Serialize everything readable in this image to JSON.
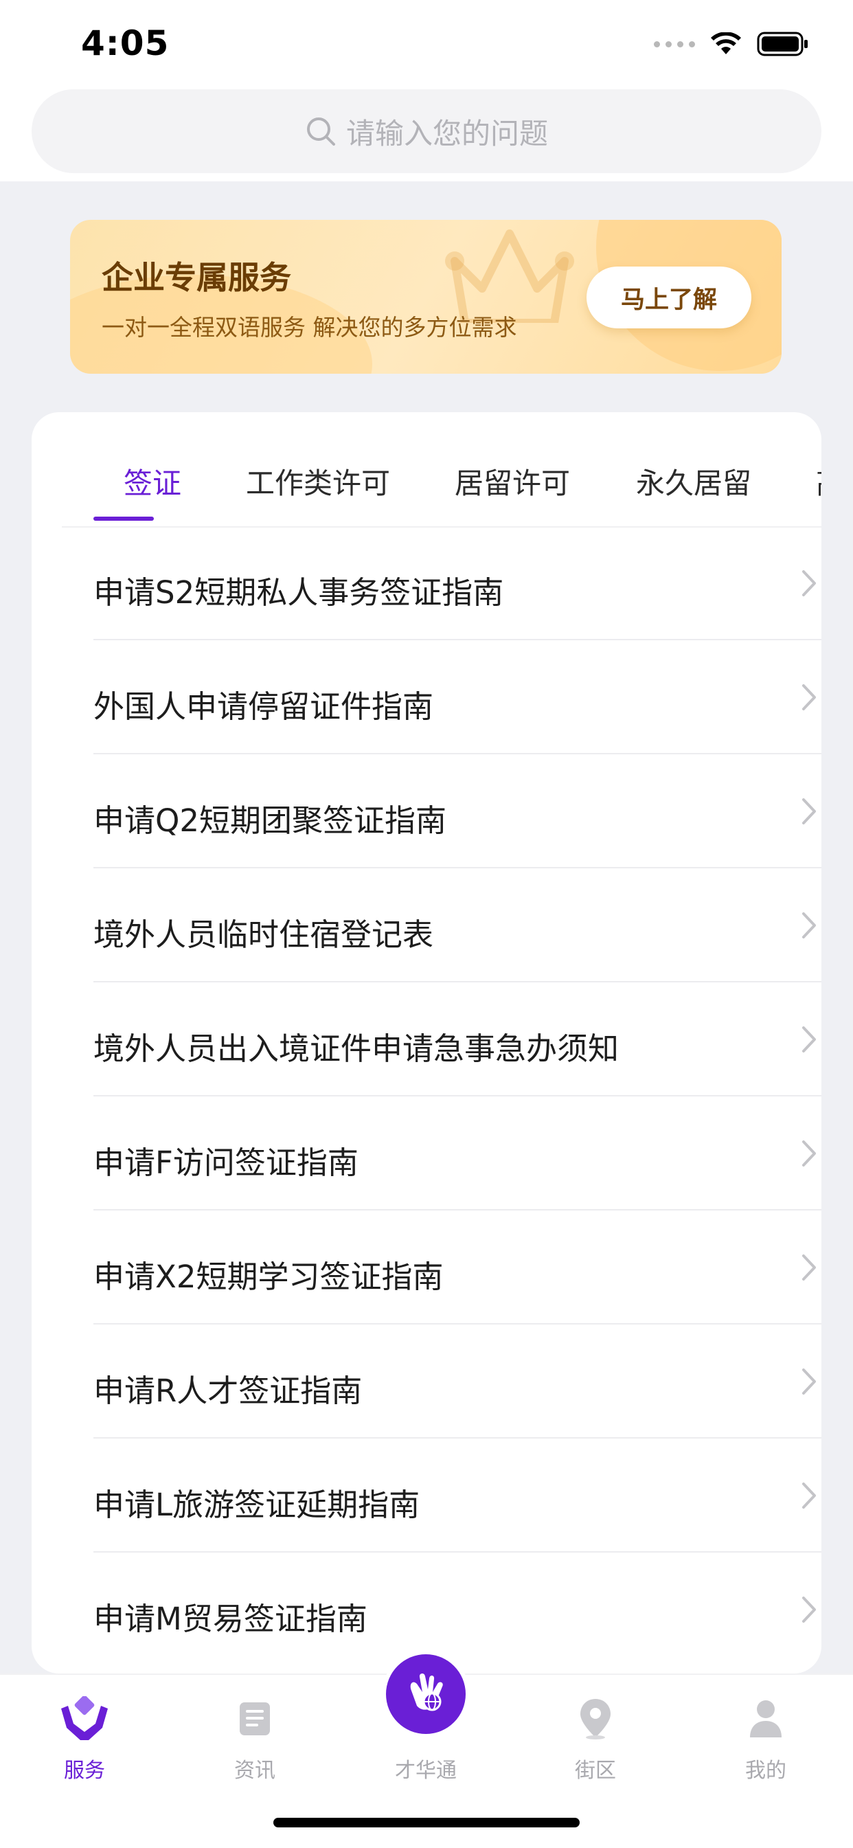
{
  "status_bar": {
    "time": "4:05"
  },
  "search": {
    "placeholder": "请输入您的问题",
    "icon": "search-icon"
  },
  "banner": {
    "title": "企业专属服务",
    "subtitle": "一对一全程双语服务 解决您的多方位需求",
    "button_label": "马上了解"
  },
  "tabs": [
    {
      "label": "签证",
      "active": true
    },
    {
      "label": "工作类许可",
      "active": false
    },
    {
      "label": "居留许可",
      "active": false
    },
    {
      "label": "永久居留",
      "active": false
    },
    {
      "label": "高端",
      "active": false
    }
  ],
  "items": [
    {
      "label": "申请S2短期私人事务签证指南"
    },
    {
      "label": "外国人申请停留证件指南"
    },
    {
      "label": "申请Q2短期团聚签证指南"
    },
    {
      "label": "境外人员临时住宿登记表"
    },
    {
      "label": "境外人员出入境证件申请急事急办须知"
    },
    {
      "label": "申请F访问签证指南"
    },
    {
      "label": "申请X2短期学习签证指南"
    },
    {
      "label": "申请R人才签证指南"
    },
    {
      "label": "申请L旅游签证延期指南"
    },
    {
      "label": "申请M贸易签证指南"
    }
  ],
  "tabbar": {
    "items": [
      {
        "label": "服务",
        "icon": "service-hands-icon",
        "active": true
      },
      {
        "label": "资讯",
        "icon": "news-document-icon",
        "active": false
      },
      {
        "label": "才华通",
        "icon": "hand-globe-icon",
        "active": false
      },
      {
        "label": "街区",
        "icon": "location-pin-icon",
        "active": false
      },
      {
        "label": "我的",
        "icon": "person-icon",
        "active": false
      }
    ]
  },
  "colors": {
    "accent": "#6a1fd6",
    "background": "#eff0f4",
    "banner_text": "#6a3d05",
    "inactive": "#a9a9ae"
  }
}
